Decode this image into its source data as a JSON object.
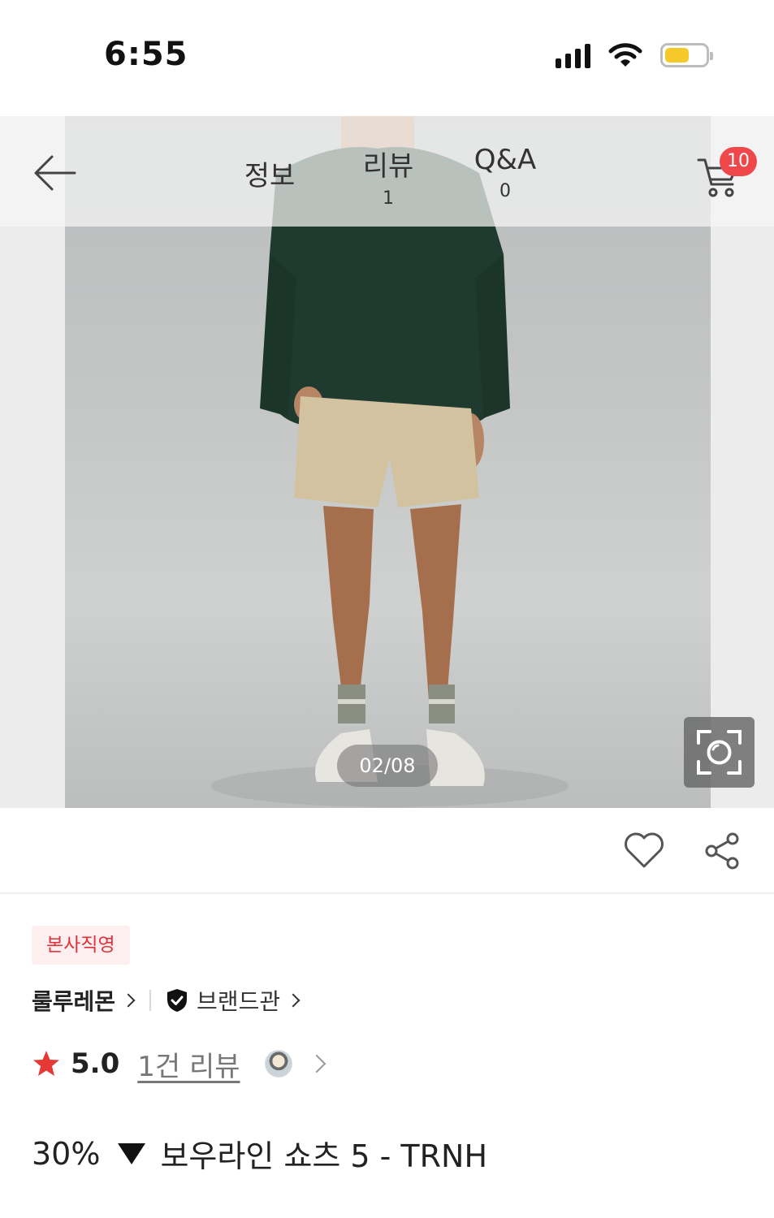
{
  "status_bar": {
    "time": "6:55",
    "icons": [
      "cellular-signal-icon",
      "wifi-icon",
      "battery-icon"
    ],
    "battery_color": "#f6c92a"
  },
  "top_nav": {
    "back_icon": "arrow-left-icon",
    "tabs": [
      {
        "label": "정보",
        "count": ""
      },
      {
        "label": "리뷰",
        "count": "1"
      },
      {
        "label": "Q&A",
        "count": "0"
      }
    ],
    "cart": {
      "icon": "cart-icon",
      "badge": "10",
      "badge_color": "#f0474a"
    }
  },
  "gallery": {
    "page_indicator": "02/08",
    "lens_icon": "camera-lens-search-icon"
  },
  "actions": {
    "like_icon": "heart-icon",
    "share_icon": "share-icon"
  },
  "product": {
    "official_badge": "본사직영",
    "brand_name": "룰루레몬",
    "brand_shop_label": "브랜드관",
    "rating": "5.0",
    "review_link": "1건 리뷰",
    "discount": "30%",
    "title": "보우라인 쇼츠 5 - TRNH",
    "accent_color": "#e0323a"
  }
}
